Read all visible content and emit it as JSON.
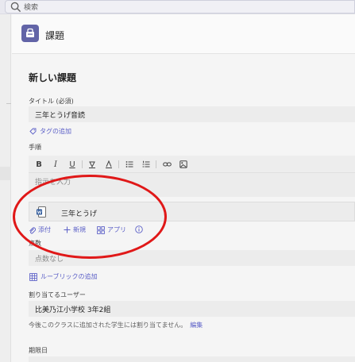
{
  "search": {
    "placeholder": "検索"
  },
  "header": {
    "title": "課題"
  },
  "form": {
    "section_title": "新しい課題",
    "title_label": "タイトル (必須)",
    "title_value": "三年とうげ音読",
    "add_tag": "タグの追加",
    "instructions_label": "手順",
    "instructions_placeholder": "指示を入力",
    "attachment_name": "三年とうげ",
    "actions": {
      "attach": "添付",
      "new": "新規",
      "apps": "アプリ"
    },
    "points_label": "点数",
    "points_placeholder": "点数なし",
    "add_rubric": "ルーブリックの追加",
    "assign_label": "割り当てるユーザー",
    "assign_value": "比美乃江小学校 3年2組",
    "assign_note": "今後このクラスに追加された学生には割り当てません。",
    "edit": "編集",
    "due_label": "期限日"
  },
  "colors": {
    "accent": "#5b5fc7",
    "brand": "#6264a7",
    "annotation": "#e01818"
  },
  "icons": [
    "search-icon",
    "assignment-icon",
    "tag-icon",
    "word-doc-icon",
    "paperclip-icon",
    "plus-icon",
    "apps-icon",
    "info-icon",
    "rubric-icon"
  ]
}
